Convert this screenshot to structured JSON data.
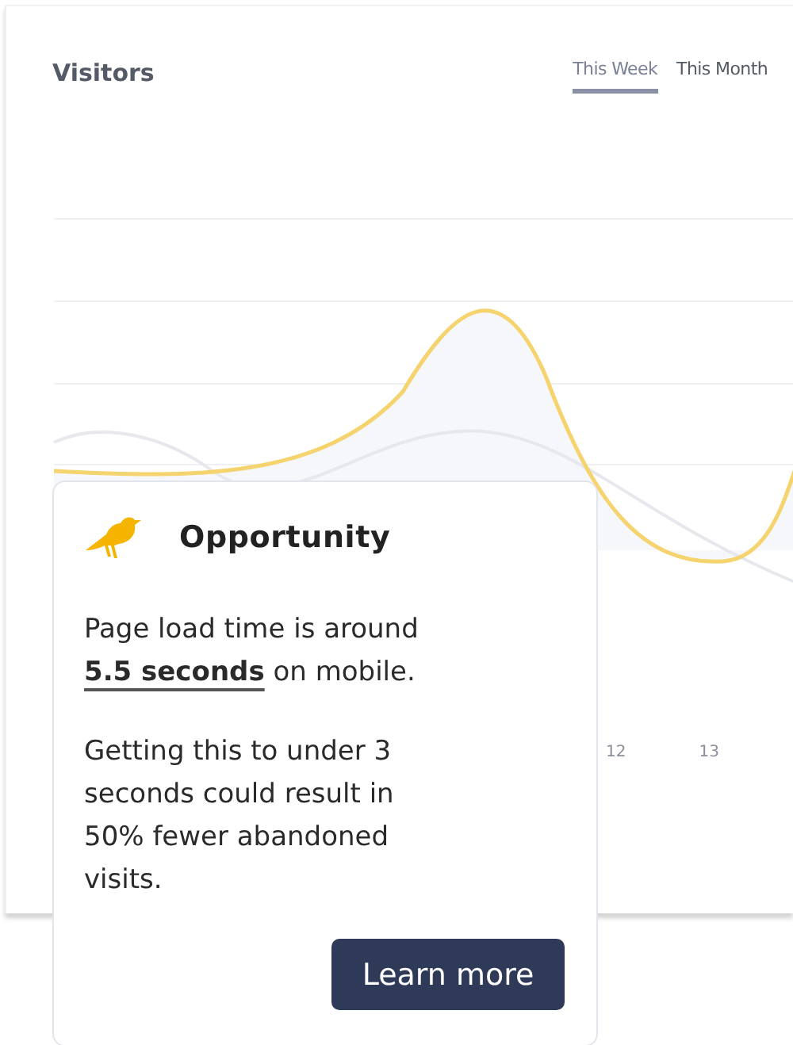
{
  "panel": {
    "title": "Visitors",
    "tabs": [
      {
        "label": "This Week",
        "selected": true
      },
      {
        "label": "This Month",
        "selected": false
      }
    ],
    "axis_labels": [
      "12",
      "13"
    ]
  },
  "card": {
    "title": "Opportunity",
    "paragraphs": [
      "Page load time is around **5.5 seconds** on mobile.",
      "Getting this to under 3 seconds could result in 50% fewer abandoned visits."
    ],
    "button": "Learn more"
  }
}
